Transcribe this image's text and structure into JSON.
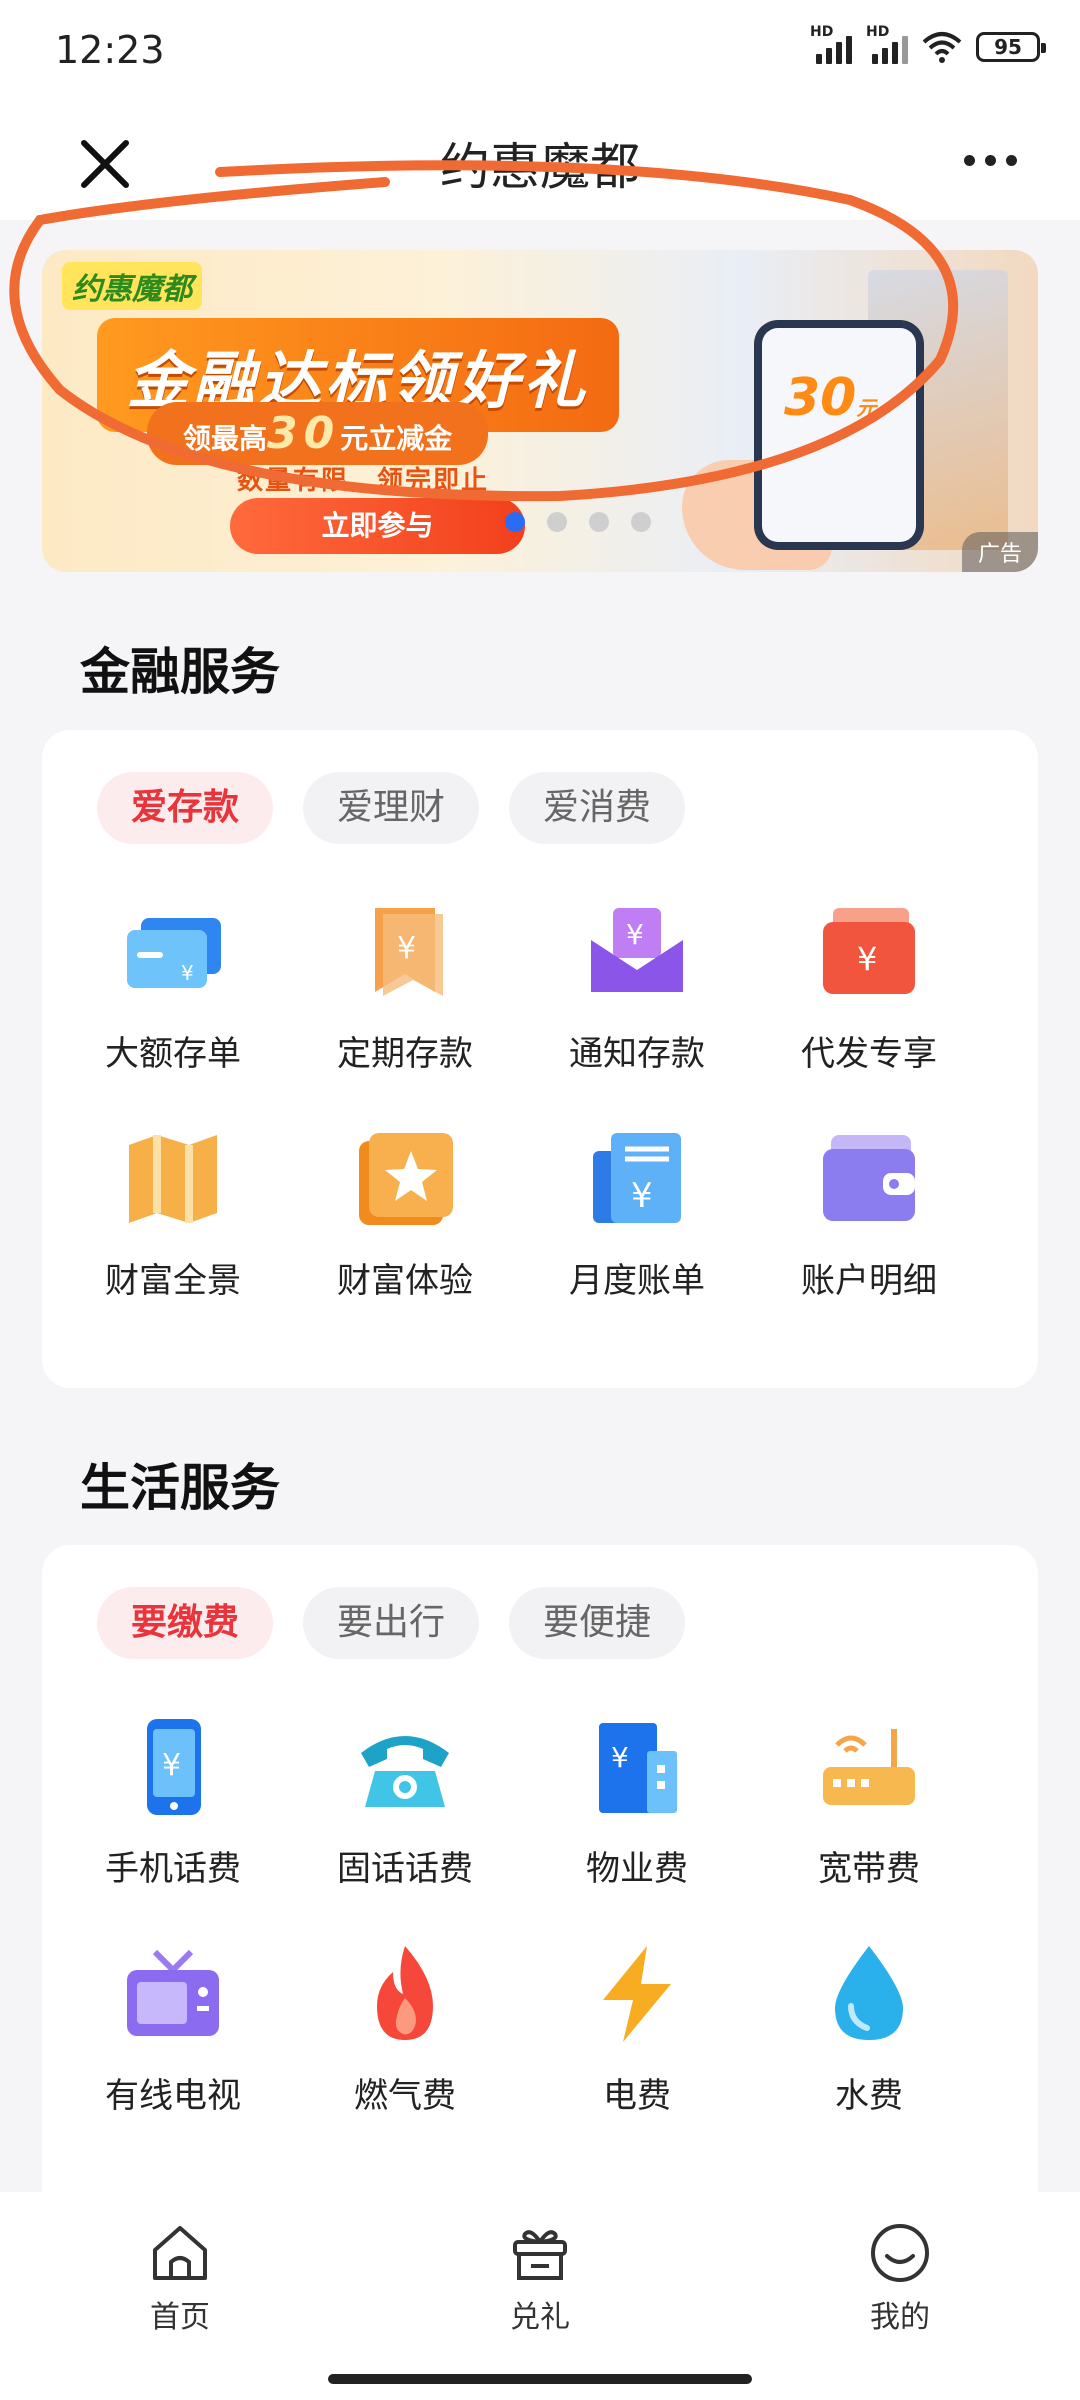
{
  "status_bar": {
    "time": "12:23",
    "battery": "95",
    "net1": "HD",
    "net2": "HD"
  },
  "header": {
    "title": "约惠魔都",
    "close_icon": "close-icon",
    "more_icon": "more-icon"
  },
  "banner": {
    "logo": "约惠魔都",
    "headline": "金融达标领好礼",
    "subline_prefix": "领最高",
    "subline_amount": "30",
    "subline_suffix": "元立减金",
    "note": "数量有限，领完即止",
    "cta": "立即参与",
    "phone_amount": "30",
    "phone_unit": "元",
    "ad_label": "广告",
    "active_dot": 0
  },
  "finance": {
    "title": "金融服务",
    "tabs": [
      "爱存款",
      "爱理财",
      "爱消费"
    ],
    "items": [
      {
        "label": "大额存单",
        "icon": "card-icon"
      },
      {
        "label": "定期存款",
        "icon": "yuan-bookmark-icon"
      },
      {
        "label": "通知存款",
        "icon": "yuan-envelope-icon"
      },
      {
        "label": "代发专享",
        "icon": "yuan-wallet-icon"
      },
      {
        "label": "财富全景",
        "icon": "map-icon"
      },
      {
        "label": "财富体验",
        "icon": "star-book-icon"
      },
      {
        "label": "月度账单",
        "icon": "bill-icon"
      },
      {
        "label": "账户明细",
        "icon": "wallet-icon"
      }
    ]
  },
  "life": {
    "title": "生活服务",
    "tabs": [
      "要缴费",
      "要出行",
      "要便捷"
    ],
    "items": [
      {
        "label": "手机话费",
        "icon": "mobile-icon"
      },
      {
        "label": "固话话费",
        "icon": "telephone-icon"
      },
      {
        "label": "物业费",
        "icon": "building-icon"
      },
      {
        "label": "宽带费",
        "icon": "router-icon"
      },
      {
        "label": "有线电视",
        "icon": "tv-icon"
      },
      {
        "label": "燃气费",
        "icon": "flame-icon"
      },
      {
        "label": "电费",
        "icon": "lightning-icon"
      },
      {
        "label": "水费",
        "icon": "water-drop-icon"
      }
    ]
  },
  "bottom_nav": [
    {
      "label": "首页",
      "icon": "home-icon"
    },
    {
      "label": "兑礼",
      "icon": "gift-icon"
    },
    {
      "label": "我的",
      "icon": "smile-icon"
    }
  ]
}
